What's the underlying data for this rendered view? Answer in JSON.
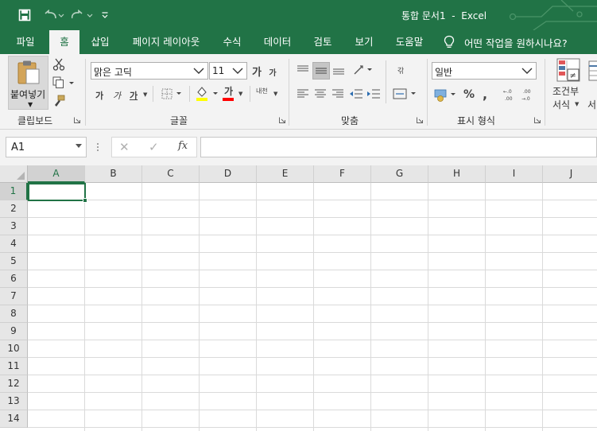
{
  "app": {
    "document_title": "통합 문서1",
    "separator": "-",
    "app_name": "Excel",
    "accent_color": "#217346"
  },
  "quick_access": {
    "save_icon": "save-icon",
    "undo_icon": "undo-icon",
    "redo_icon": "redo-icon",
    "customize_icon": "customize-qat-icon"
  },
  "tabs": [
    {
      "label": "파일",
      "active": false
    },
    {
      "label": "홈",
      "active": true
    },
    {
      "label": "삽입",
      "active": false
    },
    {
      "label": "페이지 레이아웃",
      "active": false
    },
    {
      "label": "수식",
      "active": false
    },
    {
      "label": "데이터",
      "active": false
    },
    {
      "label": "검토",
      "active": false
    },
    {
      "label": "보기",
      "active": false
    },
    {
      "label": "도움말",
      "active": false
    }
  ],
  "tell_me": {
    "text": "어떤 작업을 원하시나요?",
    "icon": "lightbulb-icon"
  },
  "ribbon": {
    "clipboard": {
      "label": "클립보드",
      "paste_label": "붙여넣기"
    },
    "font": {
      "label": "글꼴",
      "font_name": "맑은 고딕",
      "font_size": "11",
      "grow_label": "가",
      "shrink_label": "가",
      "bold_label": "가",
      "italic_label": "가",
      "underline_label": "가",
      "font_color_label": "가",
      "phonetic_label": "내천",
      "fill_color": "#ffff00",
      "font_color": "#ff0000"
    },
    "alignment": {
      "label": "맞춤",
      "wrap_label": "갂"
    },
    "number": {
      "label": "표시 형식",
      "format": "일반",
      "percent_label": "%",
      "comma_label": ","
    },
    "styles": {
      "conditional_line1": "조건부",
      "conditional_line2": "서식",
      "next_line2": "서"
    }
  },
  "formula_bar": {
    "name_box": "A1",
    "cancel_label": "✕",
    "enter_label": "✓",
    "fx_label": "fx",
    "formula": ""
  },
  "sheet": {
    "columns": [
      "A",
      "B",
      "C",
      "D",
      "E",
      "F",
      "G",
      "H",
      "I",
      "J"
    ],
    "rows": [
      "1",
      "2",
      "3",
      "4",
      "5",
      "6",
      "7",
      "8",
      "9",
      "10",
      "11",
      "12",
      "13",
      "14"
    ],
    "selected_column": "A",
    "selected_row": "1"
  }
}
